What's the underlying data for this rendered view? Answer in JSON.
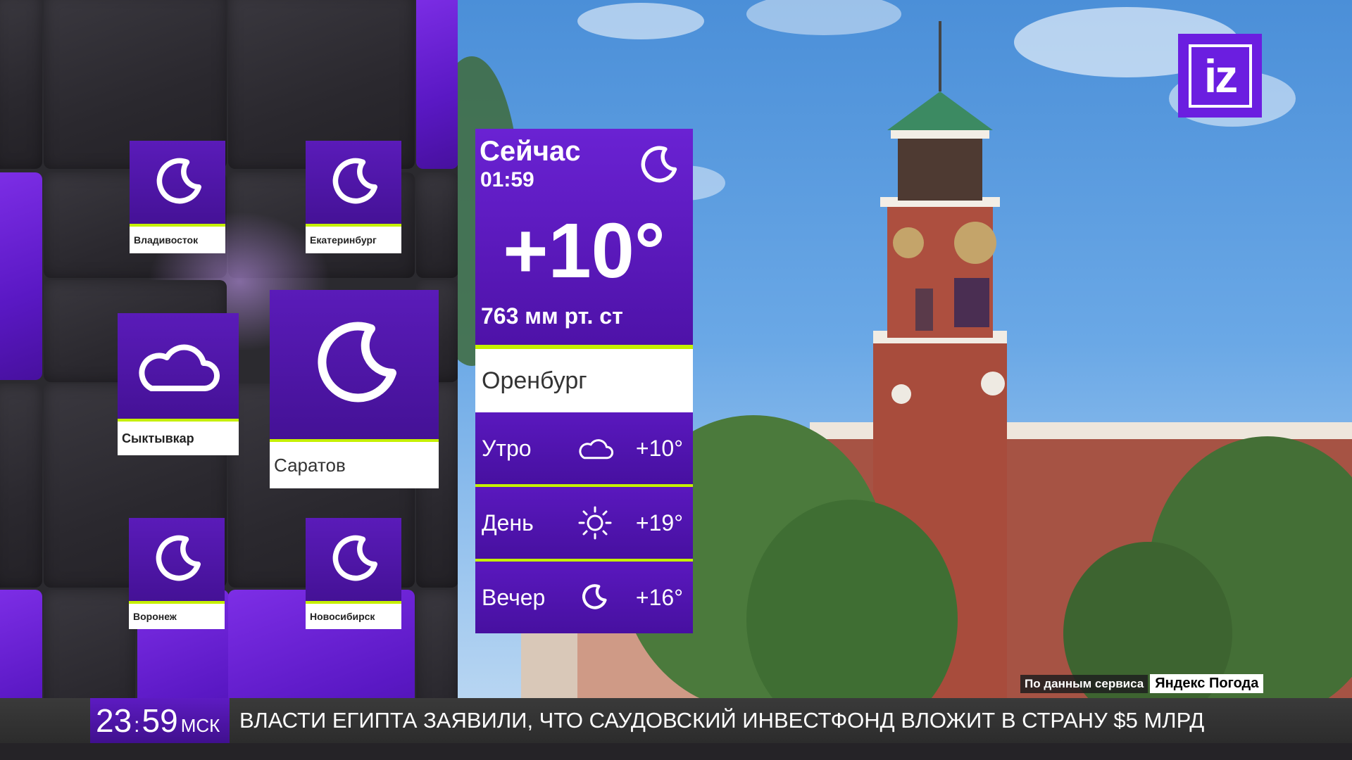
{
  "logo": {
    "text": "iz"
  },
  "tiles": [
    {
      "city": "Владивосток",
      "icon": "moon-icon"
    },
    {
      "city": "Екатеринбург",
      "icon": "moon-icon"
    },
    {
      "city": "Сыктывкар",
      "icon": "cloud-icon"
    },
    {
      "city": "Саратов",
      "icon": "moon-icon"
    },
    {
      "city": "Воронеж",
      "icon": "moon-icon"
    },
    {
      "city": "Новосибирск",
      "icon": "moon-icon"
    }
  ],
  "now": {
    "title": "Сейчас",
    "time": "01:59",
    "icon": "moon-icon",
    "temperature": "+10°",
    "pressure": "763 мм рт. ст",
    "city": "Оренбург"
  },
  "forecast": [
    {
      "label": "Утро",
      "icon": "cloud-icon",
      "temp": "+10°"
    },
    {
      "label": "День",
      "icon": "sun-icon",
      "temp": "+19°"
    },
    {
      "label": "Вечер",
      "icon": "moon-icon",
      "temp": "+16°"
    }
  ],
  "source": {
    "label": "По данным сервиса",
    "service": "Яндекс Погода"
  },
  "ticker": {
    "hours": "23",
    "minutes": "59",
    "timezone": "МСК",
    "headline": "ВЛАСТИ ЕГИПТА ЗАЯВИЛИ, ЧТО САУДОВСКИЙ ИНВЕСТФОНД ВЛОЖИТ В СТРАНУ $5 МЛРД"
  },
  "colors": {
    "accent_purple": "#6b1ee0",
    "accent_green": "#c5f000"
  }
}
